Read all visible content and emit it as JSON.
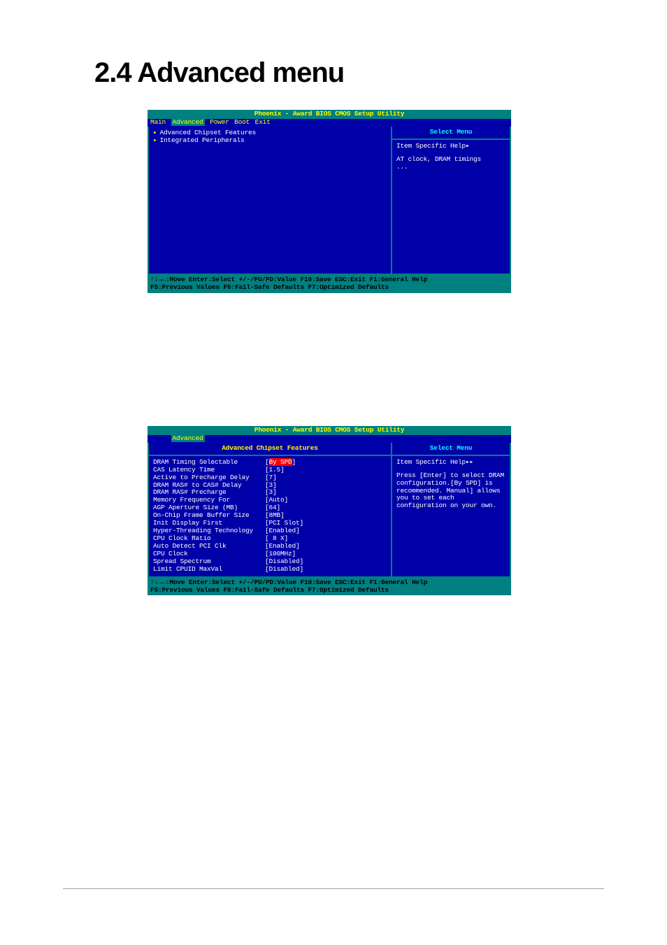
{
  "page": {
    "title": "2.4    Advanced menu"
  },
  "bios1": {
    "title": "Phoenix - Award BIOS CMOS Setup Utility",
    "menu": {
      "main": "Main",
      "advanced": "Advanced",
      "power": "Power",
      "boot": "Boot",
      "exit": "Exit"
    },
    "left": {
      "item1": "Advanced Chipset Features",
      "item2": "Integrated Peripherals"
    },
    "right": {
      "header": "Select Menu",
      "help_title": "Item Specific Help▸",
      "help_body1": "AT clock, DRAM timings",
      "help_body2": "..."
    },
    "footer_line1": "↑↓→←:Move  Enter:Select  +/-/PU/PD:Value  F10:Save  ESC:Exit  F1:General Help",
    "footer_line2": "   F5:Previous Values    F6:Fail-Safe Defaults   F7:Optimized Defaults"
  },
  "bios2": {
    "title": "Phoenix - Award BIOS CMOS Setup Utility",
    "menu": {
      "advanced": "Advanced"
    },
    "subheader": "Advanced Chipset Features",
    "items": [
      {
        "label": "DRAM Timing Selectable",
        "value": "[By SPD]"
      },
      {
        "label": "CAS Latency Time",
        "value": "[1.5]"
      },
      {
        "label": "Active to Precharge Delay",
        "value": "[7]"
      },
      {
        "label": "DRAM RAS# to CAS# Delay",
        "value": "[3]"
      },
      {
        "label": "DRAM RAS# Precharge",
        "value": "[3]"
      },
      {
        "label": "Memory Frequency For",
        "value": "[Auto]"
      },
      {
        "label": "AGP Aperture Size (MB)",
        "value": "[64]"
      },
      {
        "label": "On-Chip Frame Buffer Size",
        "value": "[8MB]"
      },
      {
        "label": "Init Display First",
        "value": "[PCI Slot]"
      },
      {
        "label": "Hyper-Threading Technology",
        "value": "[Enabled]"
      },
      {
        "label": "CPU Clock Ratio",
        "value": "[ 8 X]"
      },
      {
        "label": "Auto Detect PCI Clk",
        "value": "[Enabled]"
      },
      {
        "label": "CPU Clock",
        "value": "[100MHz]"
      },
      {
        "label": "Spread Spectrum",
        "value": "[Disabled]"
      },
      {
        "label": "Limit CPUID MaxVal",
        "value": "[Disabled]"
      }
    ],
    "right": {
      "header": "Select Menu",
      "help_title": "Item Specific Help▸▸",
      "help_body": "Press [Enter] to select DRAM configuration.[By SPD] is recommended. Manual] allows you to set each configuration on your own."
    },
    "footer_line1": "↑↓→←:Move  Enter:Select  +/-/PU/PD:Value  F10:Save  ESC:Exit  F1:General Help",
    "footer_line2": "   F5:Previous Values    F6:Fail-Safe Defaults   F7:Optimized Defaults"
  }
}
